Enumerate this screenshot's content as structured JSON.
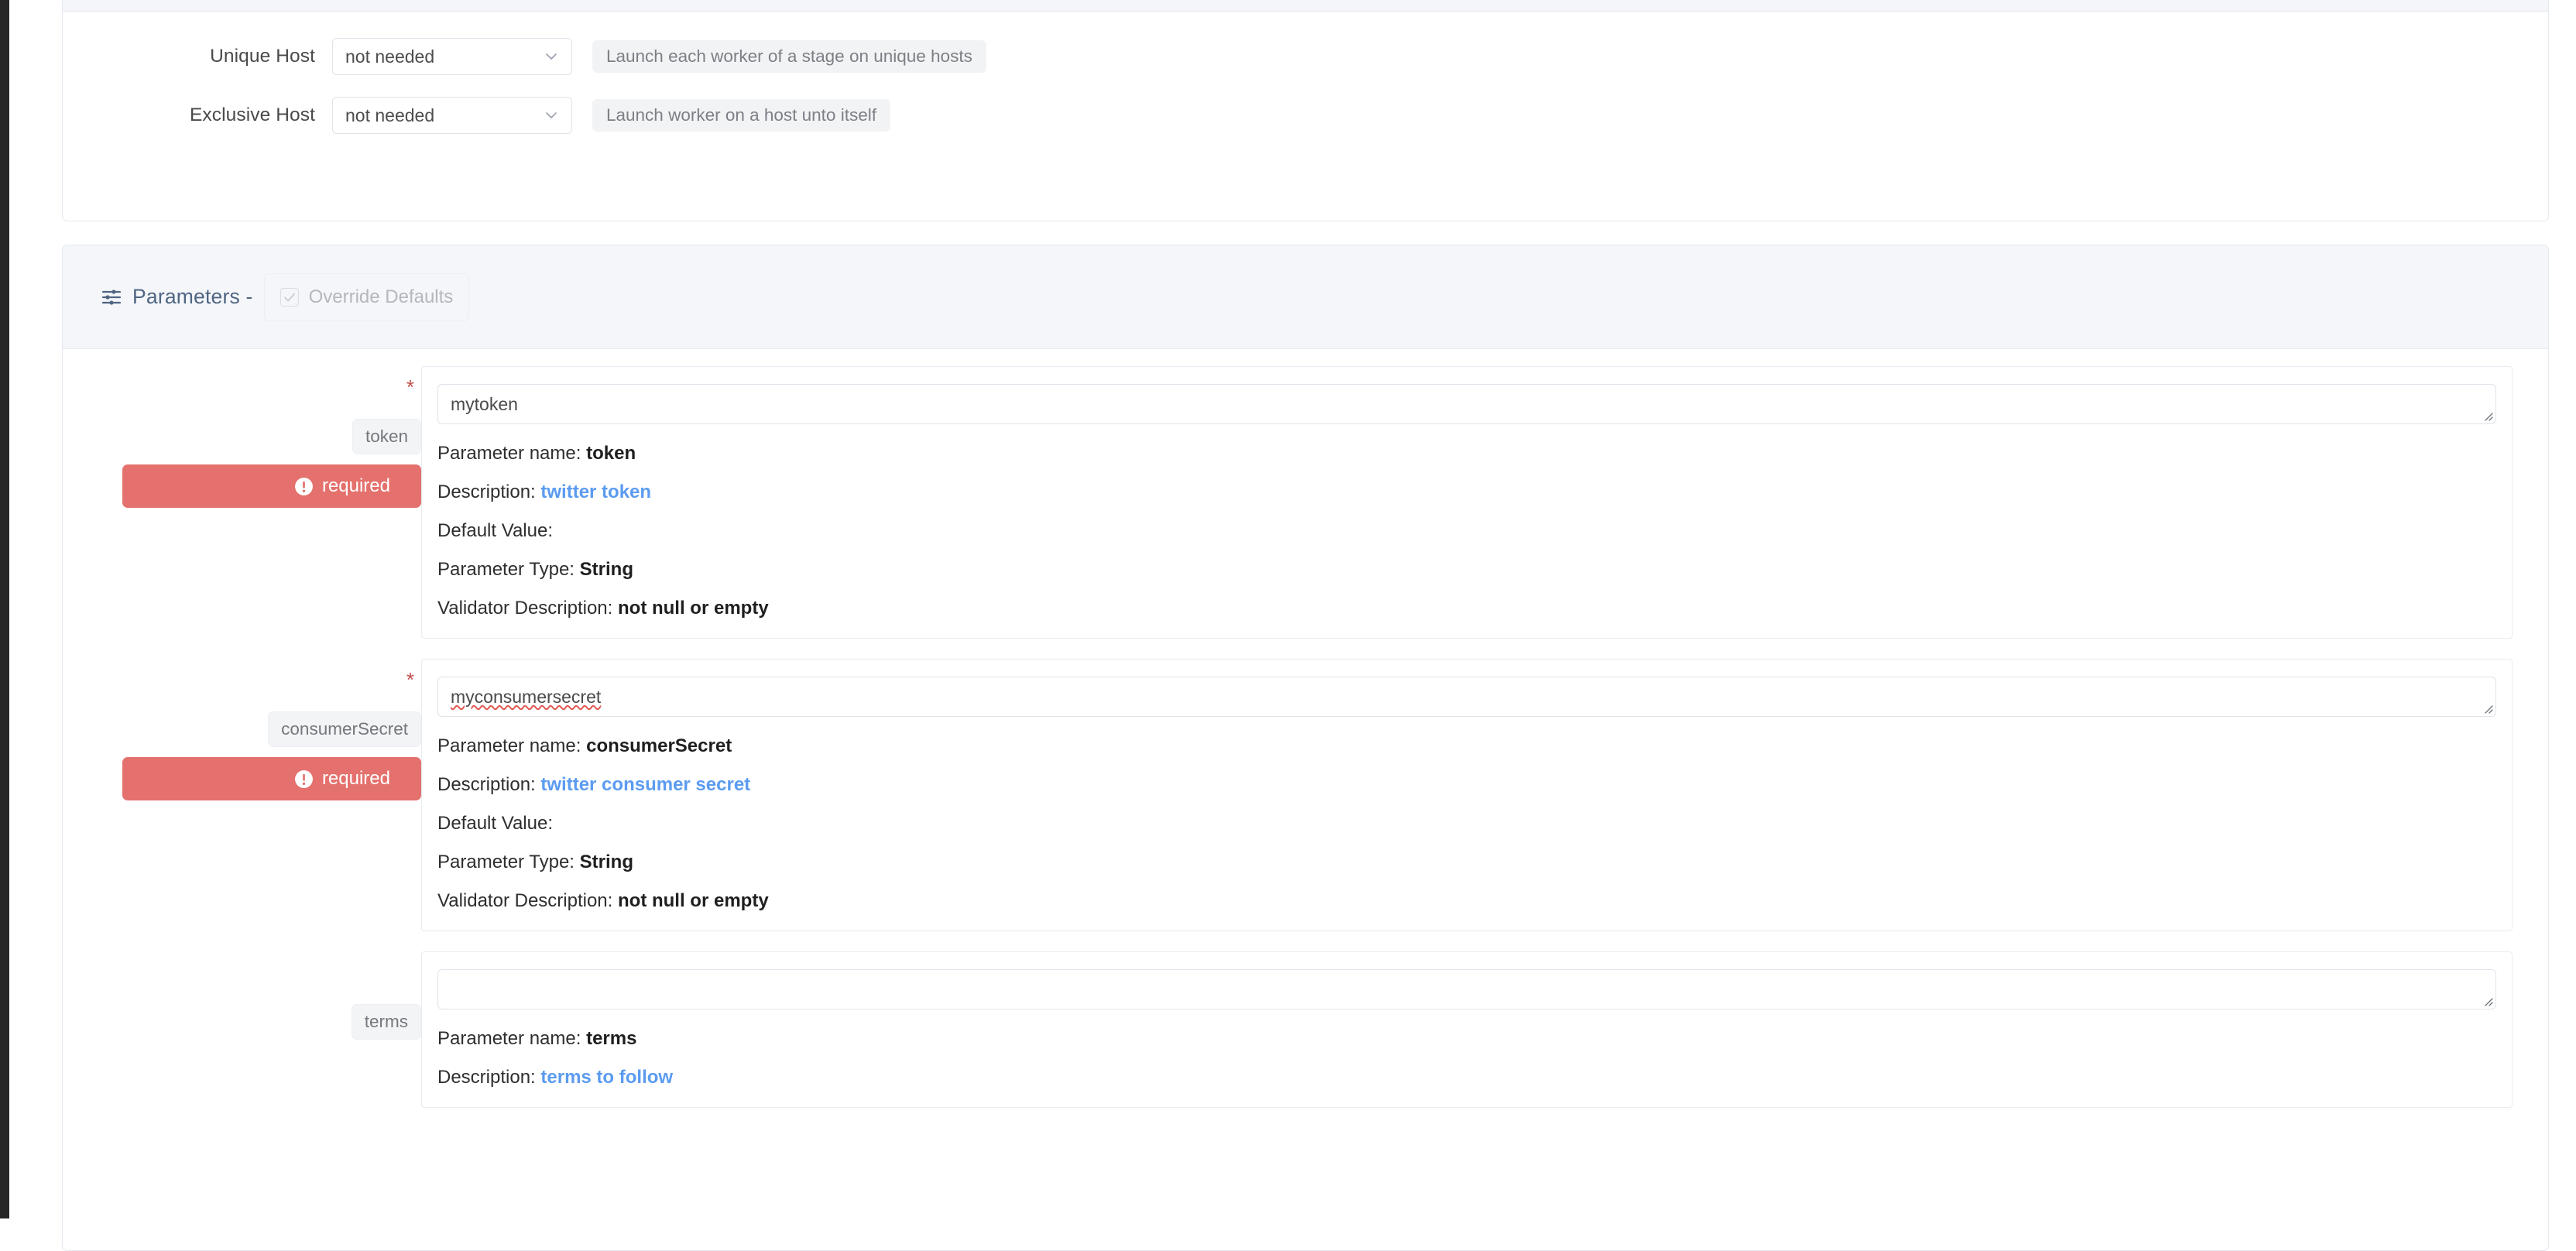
{
  "host_settings": {
    "rows": [
      {
        "label": "Unique Host",
        "select_value": "not needed",
        "hint": "Launch each worker of a stage on unique hosts"
      },
      {
        "label": "Exclusive Host",
        "select_value": "not needed",
        "hint": "Launch worker on a host unto itself"
      }
    ]
  },
  "parameters_section": {
    "title": "Parameters -",
    "icon": "sliders-icon",
    "override_defaults": {
      "label": "Override Defaults",
      "checked": true,
      "disabled": true
    },
    "labels": {
      "param_name": "Parameter name:",
      "description": "Description:",
      "default_value": "Default Value:",
      "param_type": "Parameter Type:",
      "validator_description": "Validator Description:",
      "required_badge": "required",
      "required_star": "*"
    },
    "items": [
      {
        "name": "token",
        "value": "mytoken",
        "misspelled": false,
        "required": true,
        "description": "twitter token",
        "default_value": "",
        "param_type": "String",
        "validator_description": "not null or empty"
      },
      {
        "name": "consumerSecret",
        "value": "myconsumersecret",
        "misspelled": true,
        "required": true,
        "description": "twitter consumer secret",
        "default_value": "",
        "param_type": "String",
        "validator_description": "not null or empty"
      },
      {
        "name": "terms",
        "value": "",
        "misspelled": false,
        "required": false,
        "description": "terms to follow",
        "default_value": "",
        "param_type": "",
        "validator_description": ""
      }
    ]
  },
  "colors": {
    "required_badge": "#e4716d",
    "description_link": "#5b9bf0",
    "title_slate": "#4f6582",
    "header_band": "#f4f6fa",
    "rail_dark": "#262626"
  }
}
